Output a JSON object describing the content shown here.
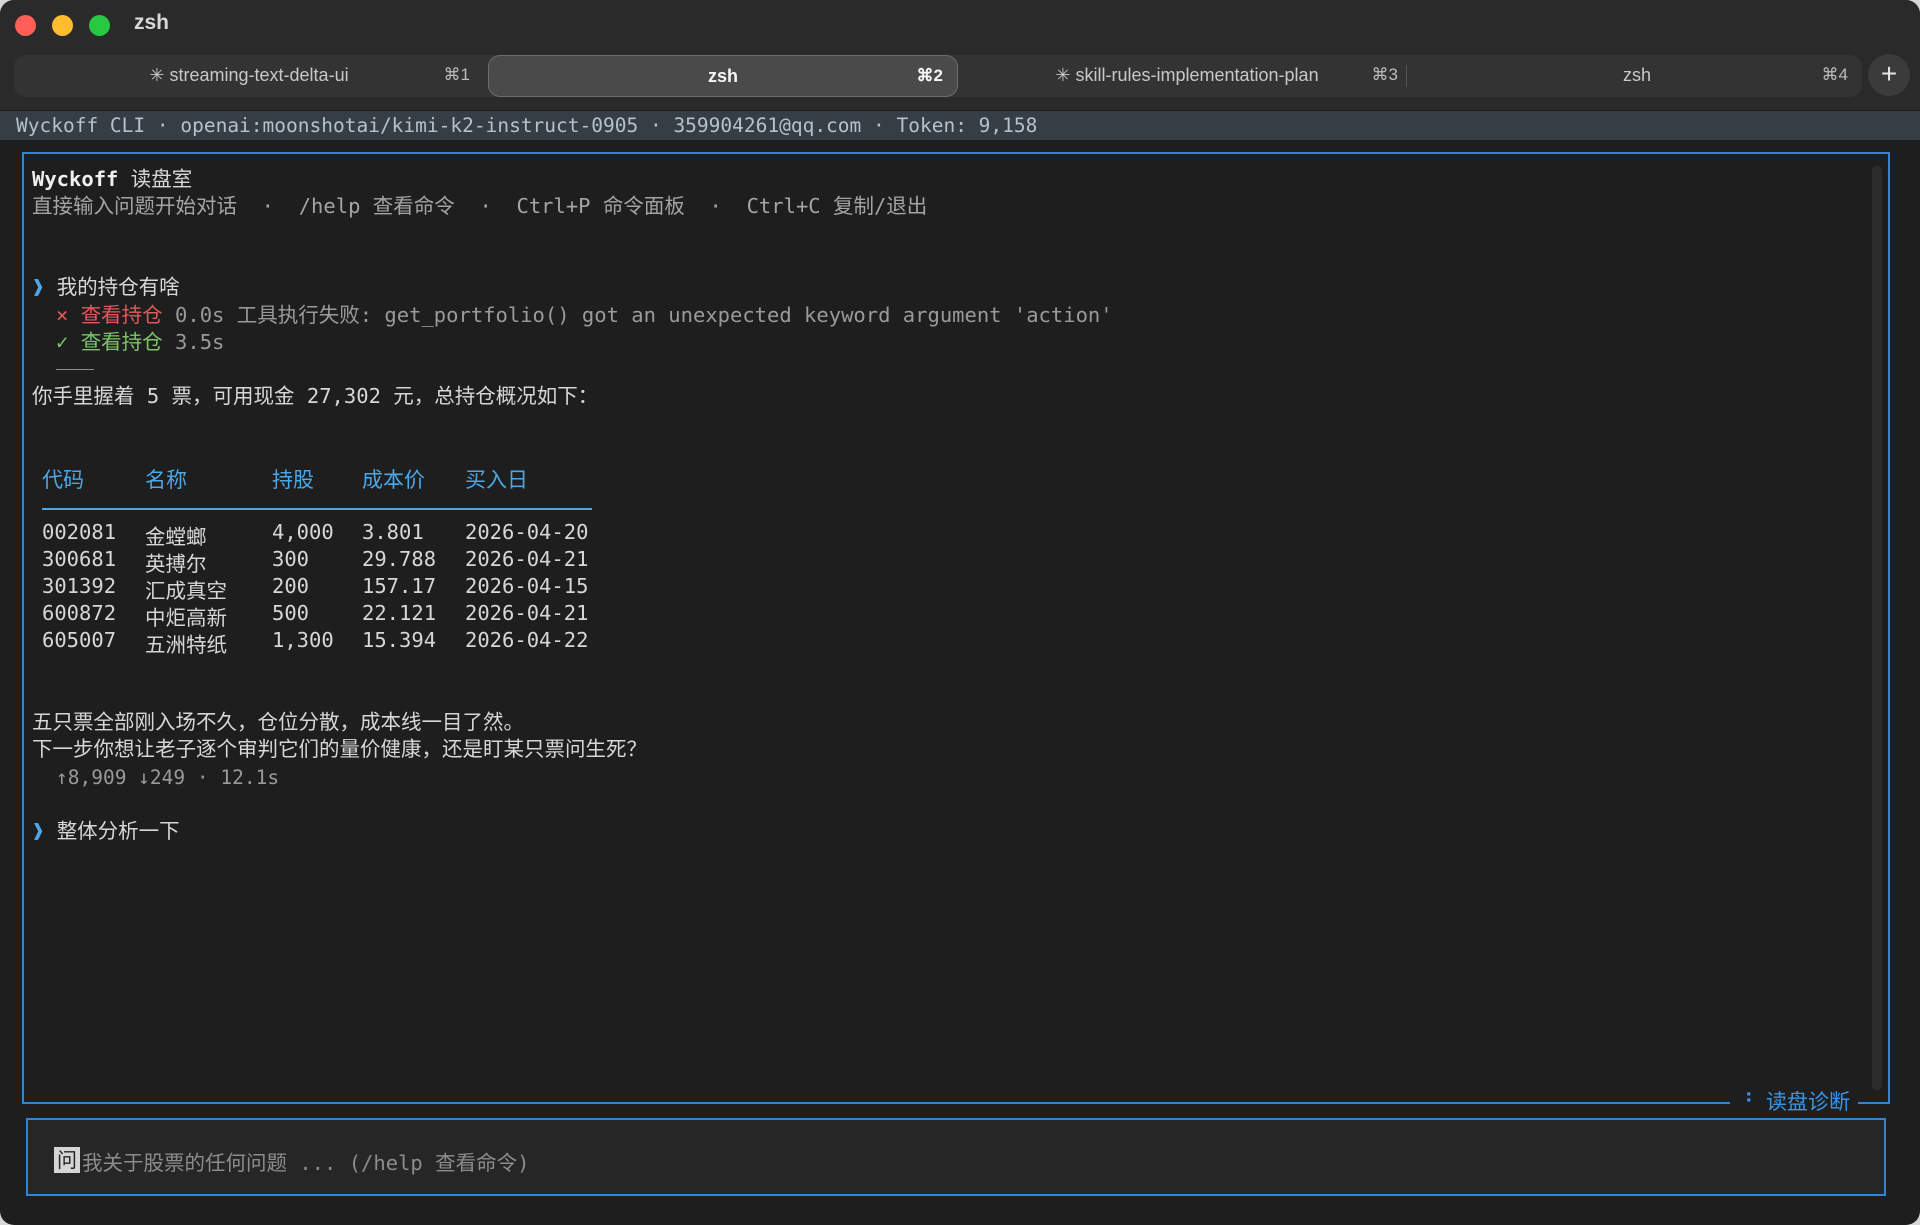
{
  "window": {
    "title": "zsh"
  },
  "tabs": [
    {
      "label": "✳ streaming-text-delta-ui",
      "shortcut": "⌘1",
      "active": false
    },
    {
      "label": "zsh",
      "shortcut": "⌘2",
      "active": true
    },
    {
      "label": "✳ skill-rules-implementation-plan",
      "shortcut": "⌘3",
      "active": false
    },
    {
      "label": "zsh",
      "shortcut": "⌘4",
      "active": false
    }
  ],
  "new_tab_label": "+",
  "status_line": "Wyckoff CLI · openai:moonshotai/kimi-k2-instruct-0905 · 359904261@qq.com · Token: 9,158",
  "header": {
    "app_name": "Wyckoff",
    "room": "读盘室",
    "hint": "直接输入问题开始对话  ·  /help 查看命令  ·  Ctrl+P 命令面板  ·  Ctrl+C 复制/退出"
  },
  "conversation": {
    "prompt_glyph": "❱",
    "user_1": "我的持仓有啥",
    "tool_error": {
      "mark": "×",
      "name": "查看持仓",
      "detail": "0.0s 工具执行失败: get_portfolio() got an unexpected keyword argument 'action'"
    },
    "tool_ok": {
      "mark": "✓",
      "name": "查看持仓",
      "detail": "3.5s"
    },
    "reply_intro": "你手里握着 5 票，可用现金 27,302 元，总持仓概况如下：",
    "table": {
      "headers": [
        "代码",
        "名称",
        "持股",
        "成本价",
        "买入日"
      ],
      "rows": [
        [
          "002081",
          "金螳螂",
          "4,000",
          "3.801",
          "2026-04-20"
        ],
        [
          "300681",
          "英搏尔",
          "300",
          "29.788",
          "2026-04-21"
        ],
        [
          "301392",
          "汇成真空",
          "200",
          "157.17",
          "2026-04-15"
        ],
        [
          "600872",
          "中炬高新",
          "500",
          "22.121",
          "2026-04-21"
        ],
        [
          "605007",
          "五洲特纸",
          "1,300",
          "15.394",
          "2026-04-22"
        ]
      ]
    },
    "reply_line_1": "五只票全部刚入场不久，仓位分散，成本线一目了然。",
    "reply_line_2": "下一步你想让老子逐个审判它们的量价健康，还是盯某只票问生死？",
    "reply_meta": "↑8,909 ↓249 · 12.1s",
    "user_2": "整体分析一下"
  },
  "panel_label": "⠘ 读盘诊断",
  "input": {
    "cursor_char": "问",
    "placeholder": "我关于股票的任何问题 ... (/help 查看命令)"
  },
  "colors": {
    "accent": "#2f86d6",
    "error": "#e05a5a",
    "success": "#7ec46b",
    "table_header": "#4aa8e8"
  }
}
